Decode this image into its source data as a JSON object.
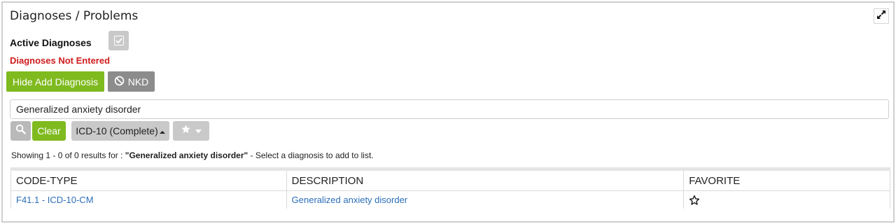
{
  "panel": {
    "title": "Diagnoses / Problems",
    "active_label": "Active Diagnoses",
    "not_entered": "Diagnoses Not Entered"
  },
  "buttons": {
    "hide_add": "Hide Add Diagnosis",
    "nkd": "NKD",
    "clear": "Clear",
    "codeset": "ICD-10 (Complete)"
  },
  "search": {
    "value": "Generalized anxiety disorder"
  },
  "results": {
    "prefix": "Showing 1 - 0 of 0 results for : ",
    "query": "\"Generalized anxiety disorder\"",
    "suffix": " - Select a diagnosis to add to list."
  },
  "table": {
    "headers": [
      "CODE-TYPE",
      "DESCRIPTION",
      "FAVORITE"
    ],
    "rows": [
      {
        "code_type": "F41.1 - ICD-10-CM",
        "description": "Generalized anxiety disorder"
      }
    ]
  },
  "icons": {
    "expand": "expand-icon",
    "check": "checkbox-icon",
    "no": "prohibited-icon",
    "search": "search-icon",
    "caret": "caret-up-icon",
    "star": "star-icon",
    "favorite": "star-outline-icon"
  },
  "colors": {
    "green": "#7fba1f",
    "error": "#d01b1b",
    "link": "#2c6fb8"
  }
}
